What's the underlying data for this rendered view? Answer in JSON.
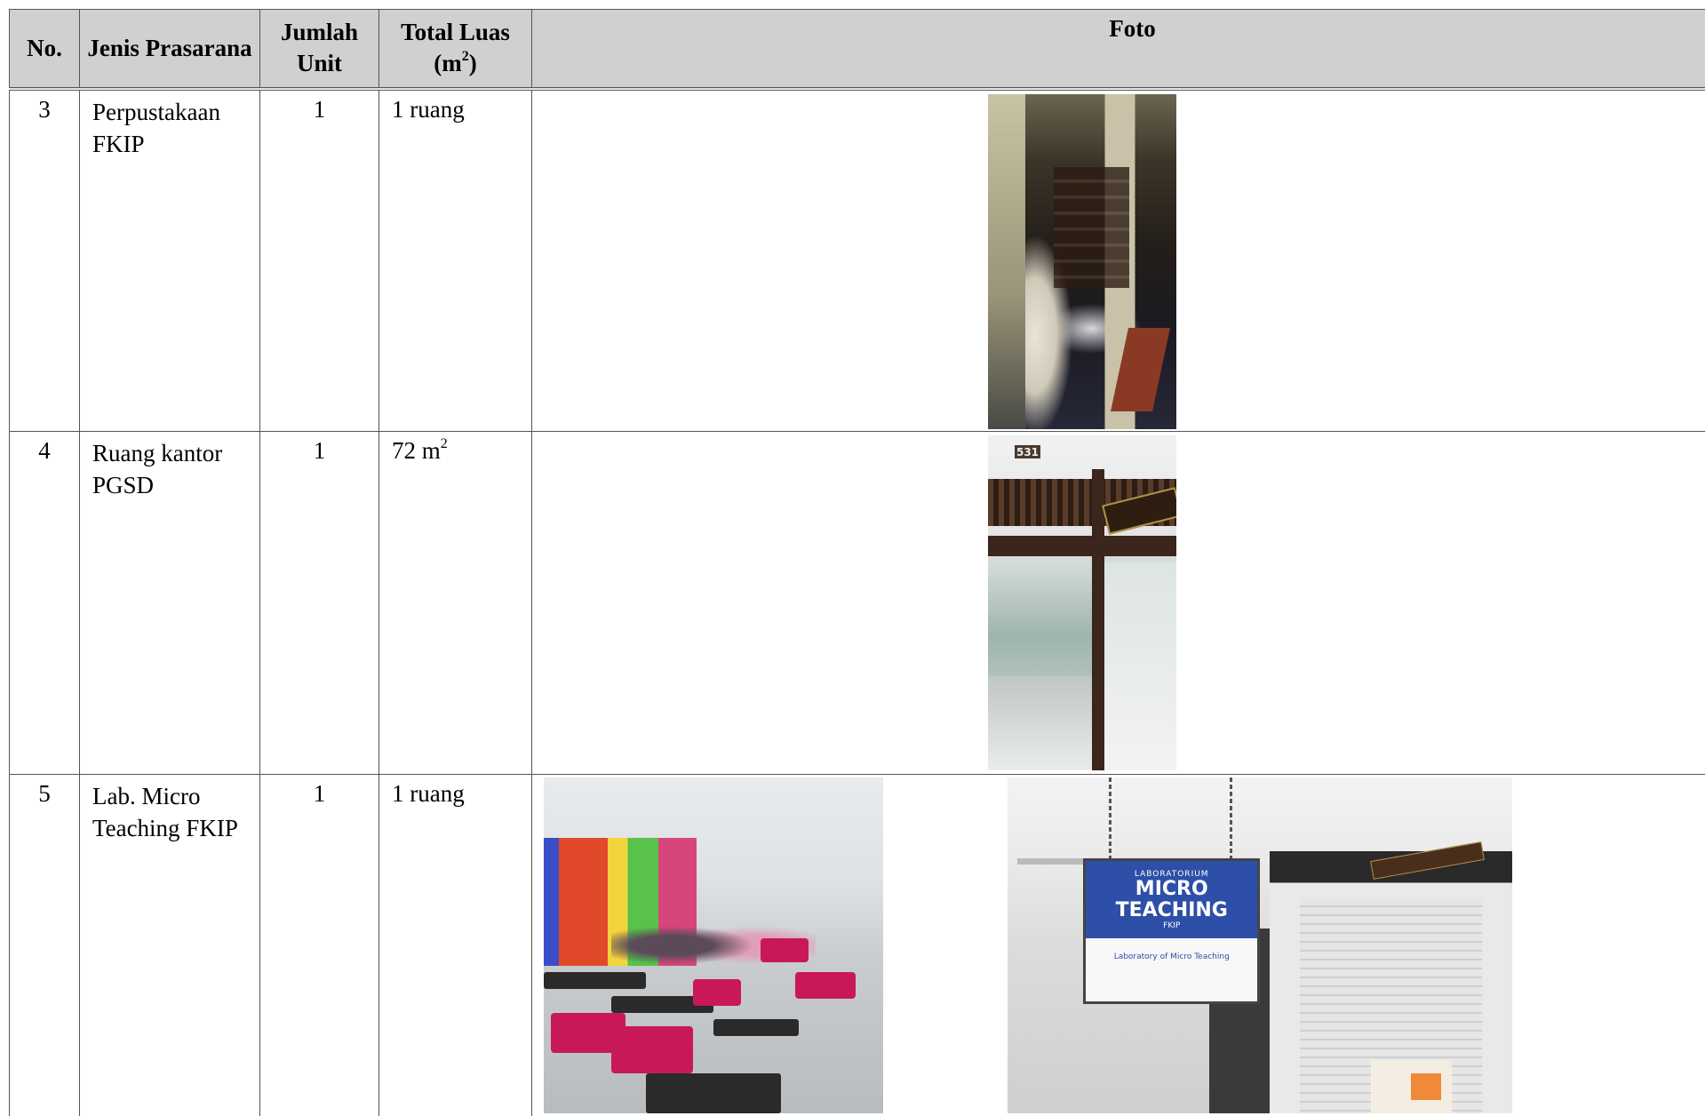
{
  "table": {
    "headers": {
      "no": "No.",
      "jenis": "Jenis Prasarana",
      "jumlah": "Jumlah Unit",
      "luas_line1": "Total Luas",
      "luas_line2_pre": "(m",
      "luas_line2_sup": "2",
      "luas_line2_post": ")",
      "foto": "Foto"
    },
    "rows": [
      {
        "no": "3",
        "jenis": "Perpustakaan FKIP",
        "jumlah": "1",
        "luas": "1 ruang",
        "luas_sup": "",
        "photos": [
          "library-interior-photo"
        ]
      },
      {
        "no": "4",
        "jenis": "Ruang kantor PGSD",
        "jumlah": "1",
        "luas": "72 m",
        "luas_sup": "2",
        "photos": [
          "office-entrance-photo"
        ],
        "room_number": "531"
      },
      {
        "no": "5",
        "jenis": "Lab. Micro Teaching FKIP",
        "jumlah": "1",
        "luas": "1 ruang",
        "luas_sup": "",
        "photos": [
          "classroom-photo",
          "lab-sign-photo"
        ],
        "sign": {
          "line1": "LABORATORIUM",
          "line2": "MICRO TEACHING",
          "line3": "FKIP",
          "line4": "Laboratory of Micro Teaching"
        }
      }
    ]
  },
  "colors": {
    "header_bg": "#d0d0d0",
    "border": "#555555",
    "sign_blue": "#2d4fa8",
    "chair_magenta": "#c8185a"
  }
}
